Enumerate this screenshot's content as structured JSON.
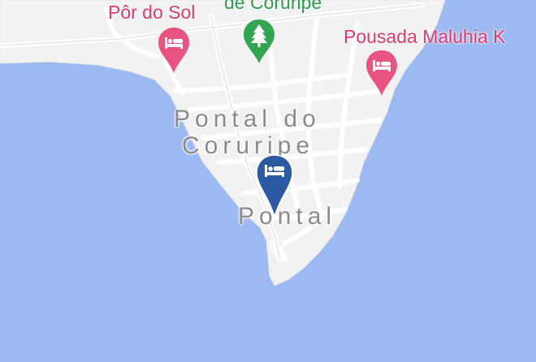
{
  "map": {
    "labels": {
      "town_1": "Pontal do",
      "town_2": "Coruripe",
      "district": "Pontal",
      "park": "de Coruripe",
      "hotel_west": "Pôr do Sol",
      "hotel_east": "Pousada Maluhia K"
    },
    "markers": {
      "selected_hotel_icon": "bed-icon",
      "hotel_icon": "bed-icon",
      "park_icon": "tree-icon"
    },
    "colors": {
      "water": "#9db9f2",
      "land": "#f2f2f2",
      "road": "#ffffff",
      "selected_pin": "#2b5aa3",
      "hotel_pin": "#e8537f",
      "park_pin": "#33a552",
      "hotel_label": "#d93b6b",
      "park_label": "#2e9a4d",
      "town_label": "#8a8a8a"
    }
  }
}
